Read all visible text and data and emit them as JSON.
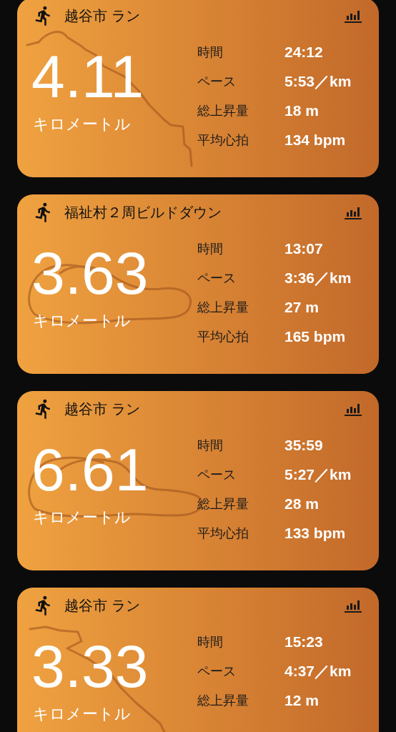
{
  "cards": [
    {
      "title": "越谷市 ラン",
      "distance": "4.11",
      "unit": "キロメートル",
      "stats": [
        {
          "label": "時間",
          "value": "24:12"
        },
        {
          "label": "ペース",
          "value": "5:53／km"
        },
        {
          "label": "総上昇量",
          "value": "18 m"
        },
        {
          "label": "平均心拍",
          "value": "134 bpm"
        }
      ]
    },
    {
      "title": "福祉村２周ビルドダウン",
      "distance": "3.63",
      "unit": "キロメートル",
      "stats": [
        {
          "label": "時間",
          "value": "13:07"
        },
        {
          "label": "ペース",
          "value": "3:36／km"
        },
        {
          "label": "総上昇量",
          "value": "27 m"
        },
        {
          "label": "平均心拍",
          "value": "165 bpm"
        }
      ]
    },
    {
      "title": "越谷市 ラン",
      "distance": "6.61",
      "unit": "キロメートル",
      "stats": [
        {
          "label": "時間",
          "value": "35:59"
        },
        {
          "label": "ペース",
          "value": "5:27／km"
        },
        {
          "label": "総上昇量",
          "value": "28 m"
        },
        {
          "label": "平均心拍",
          "value": "133 bpm"
        }
      ]
    },
    {
      "title": "越谷市 ラン",
      "distance": "3.33",
      "unit": "キロメートル",
      "stats": [
        {
          "label": "時間",
          "value": "15:23"
        },
        {
          "label": "ペース",
          "value": "4:37／km"
        },
        {
          "label": "総上昇量",
          "value": "12 m"
        }
      ]
    }
  ]
}
